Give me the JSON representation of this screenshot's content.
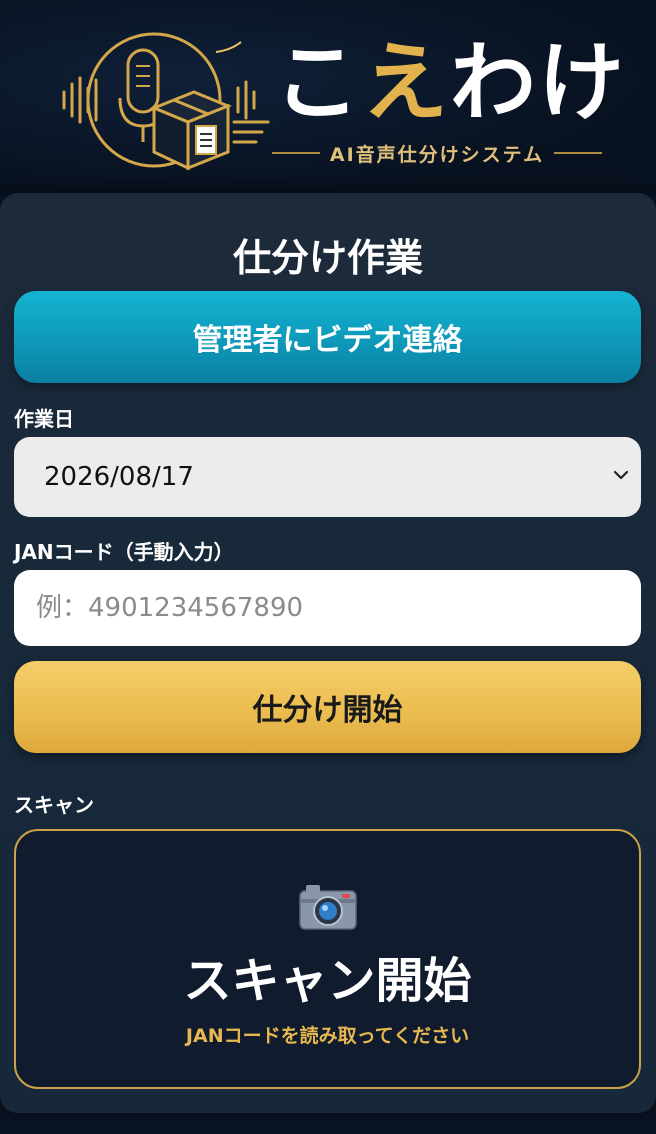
{
  "logo": {
    "title_part1": "こ",
    "title_part2": "え",
    "title_part3": "わけ",
    "subtitle": "AI音声仕分けシステム",
    "icon": "microphone-box-logo-icon"
  },
  "card": {
    "title": "仕分け作業",
    "video_button_label": "管理者にビデオ連絡",
    "date_label": "作業日",
    "date_value": "2026/08/17",
    "jan_label": "JANコード（手動入力）",
    "jan_placeholder": "例：4901234567890",
    "start_button_label": "仕分け開始",
    "scan_label": "スキャン",
    "scan_title": "スキャン開始",
    "scan_subtitle": "JANコードを読み取ってください"
  },
  "colors": {
    "accent_cyan": "#0e98b9",
    "accent_gold": "#ebbd50",
    "background": "#0a1322"
  }
}
